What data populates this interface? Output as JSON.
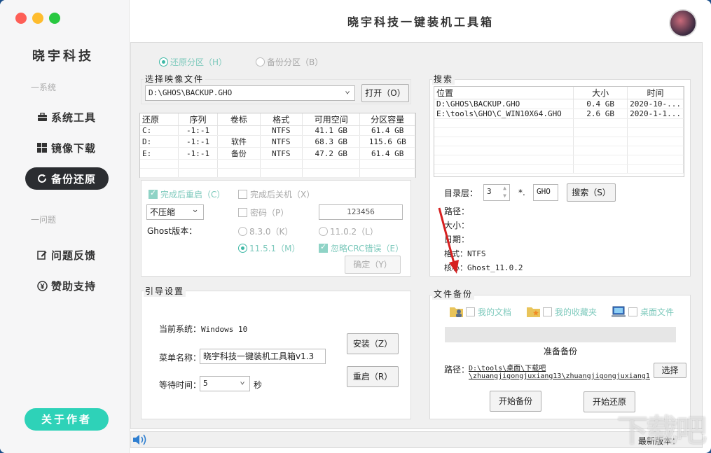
{
  "window": {
    "title": "晓宇科技一键装机工具箱"
  },
  "sidebar": {
    "brand": "晓宇科技",
    "section_system": "一系统",
    "section_issue": "一问题",
    "items": [
      {
        "label": "系统工具",
        "icon": "toolbox-icon"
      },
      {
        "label": "镜像下载",
        "icon": "windows-icon"
      },
      {
        "label": "备份还原",
        "icon": "refresh-icon"
      },
      {
        "label": "问题反馈",
        "icon": "edit-icon"
      },
      {
        "label": "赞助支持",
        "icon": "yen-icon"
      }
    ],
    "about": "关于作者"
  },
  "mode": {
    "restore": "还原分区（H）",
    "backup": "备份分区（B）"
  },
  "image": {
    "group_label": "选择映像文件",
    "path": "D:\\GHOS\\BACKUP.GHO",
    "open": "打开（O）"
  },
  "partitions": {
    "headers": [
      "还原",
      "序列",
      "卷标",
      "格式",
      "可用空间",
      "分区容量"
    ],
    "rows": [
      [
        "C:",
        "-1:-1",
        "",
        "NTFS",
        "41.1 GB",
        "61.4 GB"
      ],
      [
        "D:",
        "-1:-1",
        "软件",
        "NTFS",
        "68.3 GB",
        "115.6 GB"
      ],
      [
        "E:",
        "-1:-1",
        "备份",
        "NTFS",
        "47.2 GB",
        "61.4 GB"
      ]
    ]
  },
  "options": {
    "restart_after": "完成后重启（C）",
    "shutdown_after": "完成后关机（X）",
    "compression": "不压缩",
    "password_label": "密码（P）",
    "password_value": "123456",
    "ghost_version_label": "Ghost版本：",
    "v830": "8.3.0（K）",
    "v1102": "11.0.2（L）",
    "v1151": "11.5.1（M）",
    "ignore_crc": "忽略CRC错误（E）",
    "confirm": "确定（Y）"
  },
  "search": {
    "group_label": "搜索",
    "headers": [
      "位置",
      "大小",
      "时间"
    ],
    "rows": [
      [
        "D:\\GHOS\\BACKUP.GHO",
        "0.4 GB",
        "2020-10-..."
      ],
      [
        "E:\\tools\\GHO\\C_WIN10X64.GHO",
        "2.6 GB",
        "2020-1-1..."
      ]
    ],
    "depth_label": "目录层：",
    "depth_value": "3",
    "star": "*.",
    "ext": "GHO",
    "search_button": "搜索（S）",
    "info_path": "路径：",
    "info_size": "大小：",
    "info_date": "日期：",
    "info_format": "格式：NTFS",
    "info_core": "核心：Ghost_11.0.2"
  },
  "boot": {
    "group_label": "引导设置",
    "current_system_label": "当前系统：",
    "current_system_value": "Windows 10",
    "menu_name_label": "菜单名称：",
    "menu_name_value": "晓宇科技一键装机工具箱v1.3",
    "wait_label": "等待时间：",
    "wait_value": "5",
    "wait_unit": "秒",
    "install": "安装（Z）",
    "restart": "重启（R）"
  },
  "file_backup": {
    "group_label": "文件备份",
    "my_docs": "我的文档",
    "favorites": "我的收藏夹",
    "desktop": "桌面文件",
    "status": "准备备份",
    "path_label": "路径：",
    "path_line1": "D:\\tools\\桌面\\下载吧",
    "path_line2": "\\zhuangjigongjuxiang13\\zhuangjigongjuxiang1",
    "choose": "选择",
    "start_backup": "开始备份",
    "start_restore": "开始还原"
  },
  "statusbar": {
    "latest_version": "最新版本："
  },
  "watermark": "下载吧"
}
